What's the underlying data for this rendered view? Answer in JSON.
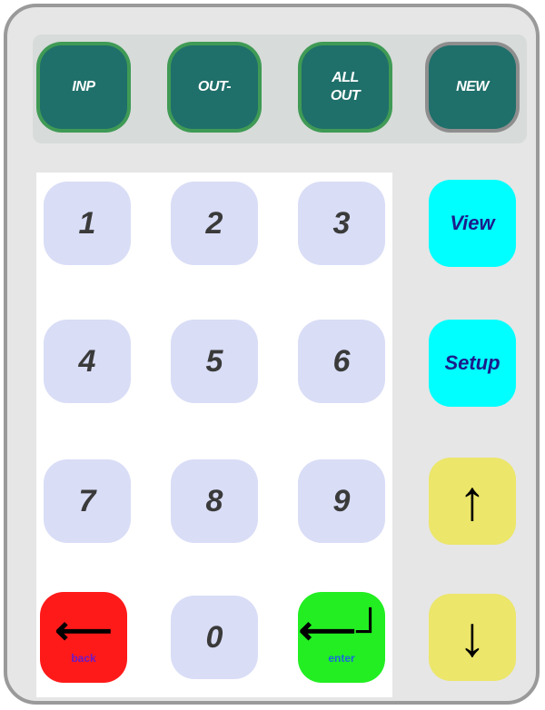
{
  "function_keys": [
    {
      "line1": "INP",
      "line2": ""
    },
    {
      "line1": "OUT-",
      "line2": ""
    },
    {
      "line1": "ALL",
      "line2": "OUT"
    },
    {
      "line1": "NEW",
      "line2": ""
    }
  ],
  "keypad": [
    "1",
    "2",
    "3",
    "4",
    "5",
    "6",
    "7",
    "8",
    "9",
    "0"
  ],
  "side": {
    "view_label": "View",
    "setup_label": "Setup",
    "up_glyph": "↑",
    "down_glyph": "↓"
  },
  "controls": {
    "back_glyph": "⟵",
    "back_sub": "back",
    "enter_glyph": "⟵┘",
    "enter_sub": "enter"
  },
  "colors": {
    "function_key": "#1f6f6a",
    "keypad_key": "#d9ddf6",
    "view_setup": "#00ffff",
    "arrows": "#ece66a",
    "back": "#ff1a1a",
    "enter": "#22ee22"
  }
}
